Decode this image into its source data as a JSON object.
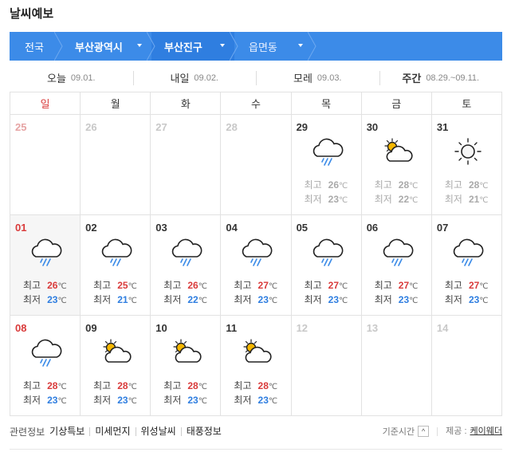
{
  "title": "날씨예보",
  "location": {
    "country": "전국",
    "city": "부산광역시",
    "district": "부산진구",
    "dong": "읍면동"
  },
  "tabs": [
    {
      "label": "오늘",
      "date": "09.01."
    },
    {
      "label": "내일",
      "date": "09.02."
    },
    {
      "label": "모레",
      "date": "09.03."
    },
    {
      "label": "주간",
      "date": "08.29.~09.11."
    }
  ],
  "weekdays": [
    "일",
    "월",
    "화",
    "수",
    "목",
    "금",
    "토"
  ],
  "high_label": "최고",
  "low_label": "최저",
  "unit": "℃",
  "weeks": [
    [
      {
        "day": "25"
      },
      {
        "day": "26"
      },
      {
        "day": "27"
      },
      {
        "day": "28"
      },
      {
        "day": "29",
        "icon": "rain-cloud-icon",
        "hi": "26",
        "lo": "23"
      },
      {
        "day": "30",
        "icon": "partly-cloudy-icon",
        "hi": "28",
        "lo": "22"
      },
      {
        "day": "31",
        "icon": "sun-icon",
        "hi": "28",
        "lo": "21"
      }
    ],
    [
      {
        "day": "01",
        "icon": "rain-cloud-icon",
        "hi": "26",
        "lo": "23"
      },
      {
        "day": "02",
        "icon": "rain-cloud-icon",
        "hi": "25",
        "lo": "21"
      },
      {
        "day": "03",
        "icon": "rain-cloud-icon",
        "hi": "26",
        "lo": "22"
      },
      {
        "day": "04",
        "icon": "rain-cloud-icon",
        "hi": "27",
        "lo": "23"
      },
      {
        "day": "05",
        "icon": "rain-cloud-icon",
        "hi": "27",
        "lo": "23"
      },
      {
        "day": "06",
        "icon": "rain-cloud-icon",
        "hi": "27",
        "lo": "23"
      },
      {
        "day": "07",
        "icon": "rain-cloud-icon",
        "hi": "27",
        "lo": "23"
      }
    ],
    [
      {
        "day": "08",
        "icon": "rain-cloud-icon",
        "hi": "28",
        "lo": "23"
      },
      {
        "day": "09",
        "icon": "partly-cloudy-icon",
        "hi": "28",
        "lo": "23"
      },
      {
        "day": "10",
        "icon": "partly-cloudy-icon",
        "hi": "28",
        "lo": "23"
      },
      {
        "day": "11",
        "icon": "partly-cloudy-icon",
        "hi": "28",
        "lo": "23"
      },
      {
        "day": "12"
      },
      {
        "day": "13"
      },
      {
        "day": "14"
      }
    ]
  ],
  "footer": {
    "related": "관련정보",
    "links": [
      "기상특보",
      "미세먼지",
      "위성날씨",
      "태풍정보"
    ],
    "standard_time": "기준시간",
    "provider_label": "제공 :",
    "provider": "케이웨더"
  },
  "colors": {
    "location_bar": "#3c8be8",
    "sunday": "#d93a3a",
    "high": "#d93a3a",
    "low": "#2f7ee0"
  }
}
